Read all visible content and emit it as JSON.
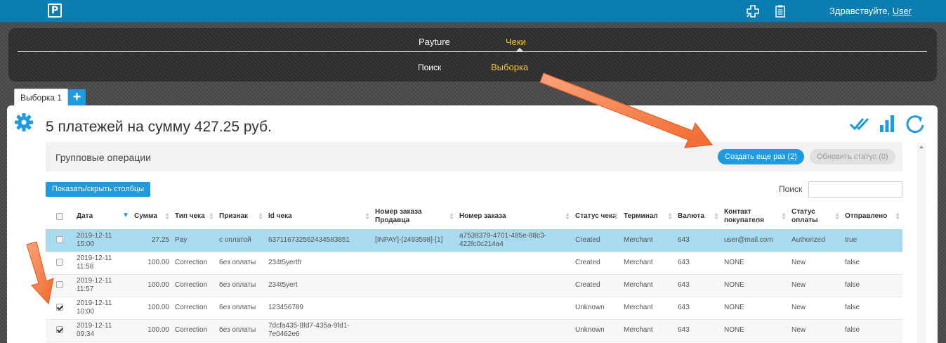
{
  "app": {
    "logo_letter": "P"
  },
  "header": {
    "greeting": "Здравствуйте,",
    "user": "User"
  },
  "nav": {
    "top": [
      {
        "label": "Payture",
        "active": false
      },
      {
        "label": "Чеки",
        "active": true
      }
    ],
    "sub": [
      {
        "label": "Поиск",
        "active": false
      },
      {
        "label": "Выборка",
        "active": true
      }
    ]
  },
  "tabs": [
    {
      "label": "Выборка 1"
    }
  ],
  "tab_add_label": "+",
  "summary": {
    "headline": "5 платежей на сумму 427.25 руб."
  },
  "group": {
    "label": "Групповые операции",
    "create_again": "Создать еще раз (2)",
    "update_status": "Обновить статус (0)"
  },
  "toolbar": {
    "toggle_columns": "Показать/скрыть столбцы",
    "search_label": "Поиск",
    "search_value": ""
  },
  "table": {
    "columns": [
      "Дата",
      "Сумма",
      "Тип чека",
      "Признак",
      "Id чека",
      "Номер заказа Продавца",
      "Номер заказа",
      "Статус чека",
      "Терминал",
      "Валюта",
      "Контакт покупателя",
      "Статус оплаты",
      "Отправлено"
    ],
    "rows": [
      {
        "checked": false,
        "selected": true,
        "cells": [
          "2019-12-11 15:00",
          "27.25",
          "Pay",
          "с оплатой",
          "637116732562434583851",
          "[INPAY]-[2493598]-[1]",
          "a7538379-4701-485e-88c3-422fc0c214a4",
          "Created",
          "Merchant",
          "643",
          "user@mail.com",
          "Authorized",
          "true"
        ]
      },
      {
        "checked": false,
        "selected": false,
        "cells": [
          "2019-12-11 11:58",
          "100.00",
          "Correction",
          "без оплаты",
          "234t5yertfr",
          "",
          "",
          "Created",
          "Merchant",
          "643",
          "NONE",
          "New",
          "false"
        ]
      },
      {
        "checked": false,
        "selected": false,
        "cells": [
          "2019-12-11 11:57",
          "100.00",
          "Correction",
          "без оплаты",
          "234t5yert",
          "",
          "",
          "Created",
          "Merchant",
          "643",
          "NONE",
          "New",
          "false"
        ]
      },
      {
        "checked": true,
        "selected": false,
        "cells": [
          "2019-12-11 10:00",
          "100.00",
          "Correction",
          "без оплаты",
          "123456789",
          "",
          "",
          "Unknown",
          "Merchant",
          "643",
          "NONE",
          "New",
          "false"
        ]
      },
      {
        "checked": true,
        "selected": false,
        "cells": [
          "2019-12-11 09:34",
          "100.00",
          "Correction",
          "без оплаты",
          "7dcfa435-8fd7-435a-9fd1-7e0462e6",
          "",
          "",
          "Unknown",
          "Merchant",
          "643",
          "NONE",
          "New",
          "false"
        ]
      }
    ]
  },
  "colors": {
    "topbar": "#0b7db0",
    "accent": "#1e9be0",
    "nav_active": "#f5c518",
    "selected_row": "#a8daf0",
    "annotation_arrow": "#f26a2e"
  }
}
